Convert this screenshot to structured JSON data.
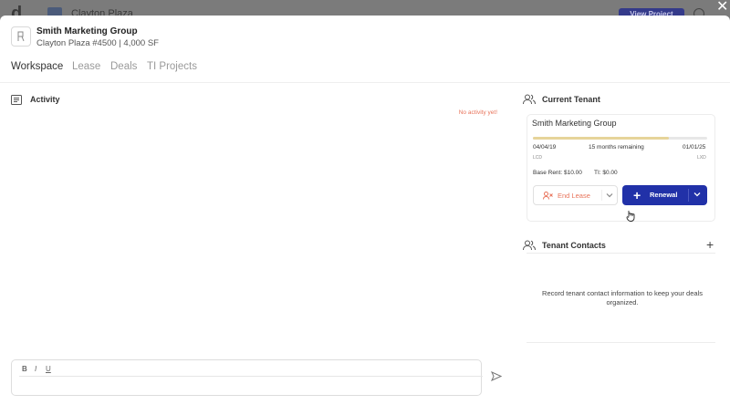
{
  "background_app": {
    "logo": "d",
    "title": "Clayton Plaza",
    "view_project_label": "View Project"
  },
  "header": {
    "tenant_name": "Smith Marketing Group",
    "subtitle": "Clayton Plaza #4500 | 4,000 SF"
  },
  "tabs": [
    {
      "label": "Workspace",
      "active": true
    },
    {
      "label": "Lease",
      "active": false
    },
    {
      "label": "Deals",
      "active": false
    },
    {
      "label": "TI Projects",
      "active": false
    }
  ],
  "activity": {
    "title": "Activity",
    "empty_text": "No activity yet!",
    "editor_format": {
      "bold": "B",
      "italic": "I",
      "underline": "U"
    }
  },
  "current_tenant": {
    "title": "Current Tenant",
    "name": "Smith Marketing Group",
    "progress_fraction": 0.78,
    "lcd": "04/04/19",
    "lcd_label": "LCD",
    "remaining": "15 months remaining",
    "lxd": "01/01/25",
    "lxd_label": "LXD",
    "base_rent": "Base Rent: $10.00",
    "ti": "TI: $0.00",
    "end_lease_label": "End Lease",
    "renewal_label": "Renewal"
  },
  "tenant_contacts": {
    "title": "Tenant Contacts",
    "empty_text": "Record tenant contact information to keep your deals organized."
  },
  "colors": {
    "accent": "#2131a8",
    "warning": "#e8735a",
    "progress": "#e6d49a"
  }
}
